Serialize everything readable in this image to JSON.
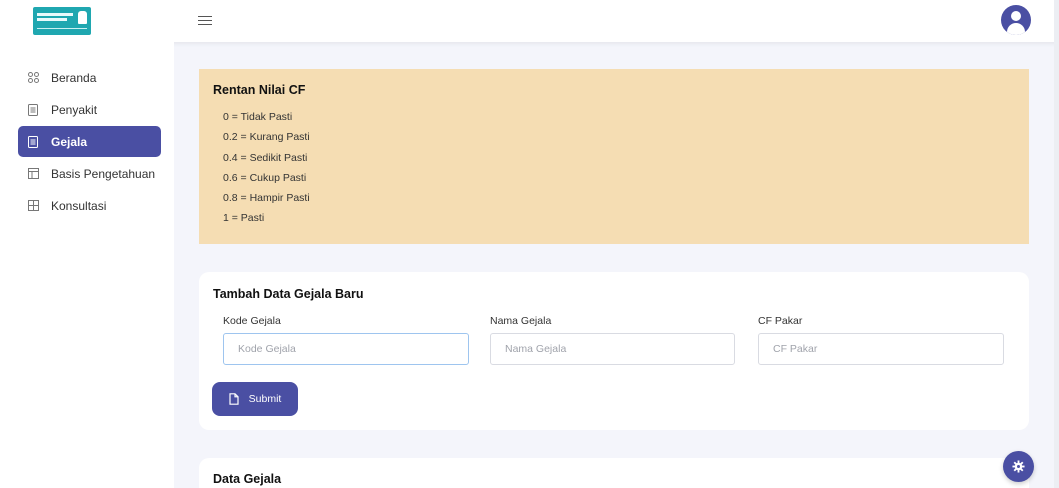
{
  "sidebar": {
    "items": [
      {
        "label": "Beranda",
        "icon": "grid-icon",
        "active": false
      },
      {
        "label": "Penyakit",
        "icon": "document-icon",
        "active": false
      },
      {
        "label": "Gejala",
        "icon": "document-icon",
        "active": true
      },
      {
        "label": "Basis Pengetahuan",
        "icon": "table-icon",
        "active": false
      },
      {
        "label": "Konsultasi",
        "icon": "table-grid-icon",
        "active": false
      }
    ]
  },
  "cf_info": {
    "title": "Rentan Nilai CF",
    "items": [
      "0 = Tidak Pasti",
      "0.2 = Kurang Pasti",
      "0.4 = Sedikit Pasti",
      "0.6 = Cukup Pasti",
      "0.8 = Hampir Pasti",
      "1 = Pasti"
    ]
  },
  "form": {
    "title": "Tambah Data Gejala Baru",
    "kode": {
      "label": "Kode Gejala",
      "placeholder": "Kode Gejala"
    },
    "nama": {
      "label": "Nama Gejala",
      "placeholder": "Nama Gejala"
    },
    "cf": {
      "label": "CF Pakar",
      "placeholder": "CF Pakar"
    },
    "submit_label": "Submit"
  },
  "data_section": {
    "title": "Data Gejala"
  },
  "colors": {
    "primary": "#4a4fa3",
    "info_bg": "#f5ddb3",
    "logo": "#1fa7b0"
  }
}
